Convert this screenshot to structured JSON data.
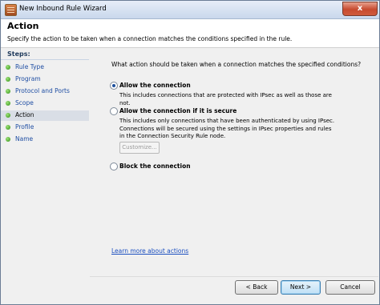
{
  "window": {
    "title": "New Inbound Rule Wizard",
    "close_label": "x"
  },
  "header": {
    "title": "Action",
    "description": "Specify the action to be taken when a connection matches the conditions specified in the rule."
  },
  "steps": {
    "title": "Steps:",
    "items": [
      {
        "label": "Rule Type"
      },
      {
        "label": "Program"
      },
      {
        "label": "Protocol and Ports"
      },
      {
        "label": "Scope"
      },
      {
        "label": "Action"
      },
      {
        "label": "Profile"
      },
      {
        "label": "Name"
      }
    ],
    "active_index": 4
  },
  "main": {
    "question": "What action should be taken when a connection matches the specified conditions?",
    "options": [
      {
        "label": "Allow the connection",
        "description": "This includes connections that are protected with IPsec as well as those are not.",
        "selected": true
      },
      {
        "label": "Allow the connection if it is secure",
        "description": "This includes only connections that have been authenticated by using IPsec.  Connections will be secured using the settings in IPsec properties and rules in the Connection Security Rule node.",
        "selected": false
      },
      {
        "label": "Block the connection",
        "description": "",
        "selected": false
      }
    ],
    "customize_label": "Customize...",
    "learn_more": "Learn more about actions"
  },
  "footer": {
    "back_label": "< Back",
    "next_label": "Next >",
    "cancel_label": "Cancel"
  }
}
